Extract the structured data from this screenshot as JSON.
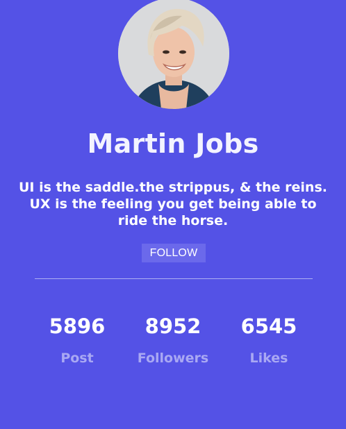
{
  "profile": {
    "name": "Martin Jobs",
    "bio": "UI is the saddle.the strippus, & the reins. UX is the feeling you get being able to ride the horse.",
    "follow_label": "FOLLOW"
  },
  "stats": [
    {
      "value": "5896",
      "label": "Post"
    },
    {
      "value": "8952",
      "label": "Followers"
    },
    {
      "value": "6545",
      "label": "Likes"
    }
  ],
  "colors": {
    "background": "#5452e6",
    "button": "#6b69eb",
    "label": "#a9a8f3",
    "divider": "#aeb0f2"
  }
}
